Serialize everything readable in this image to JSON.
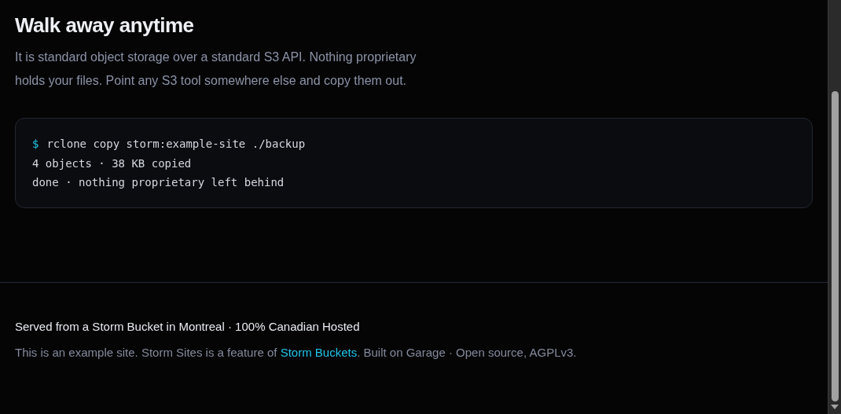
{
  "section": {
    "title": "Walk away anytime",
    "body": "It is standard object storage over a standard S3 API. Nothing proprietary holds your files. Point any S3 tool somewhere else and copy them out."
  },
  "terminal": {
    "lines": [
      {
        "kind": "command",
        "prompt": "$",
        "text": "rclone copy storm:example-site ./backup"
      },
      {
        "kind": "output",
        "text": "4 objects · 38 KB copied"
      },
      {
        "kind": "output",
        "text": "done · nothing proprietary left behind"
      }
    ]
  },
  "footer": {
    "served": "Served from a Storm Bucket in Montreal · 100% Canadian Hosted",
    "note": {
      "before": "This is an example site. Storm Sites is a feature of ",
      "link": "Storm Buckets",
      "after": ". Built on Garage · Open source, AGPLv3."
    }
  }
}
